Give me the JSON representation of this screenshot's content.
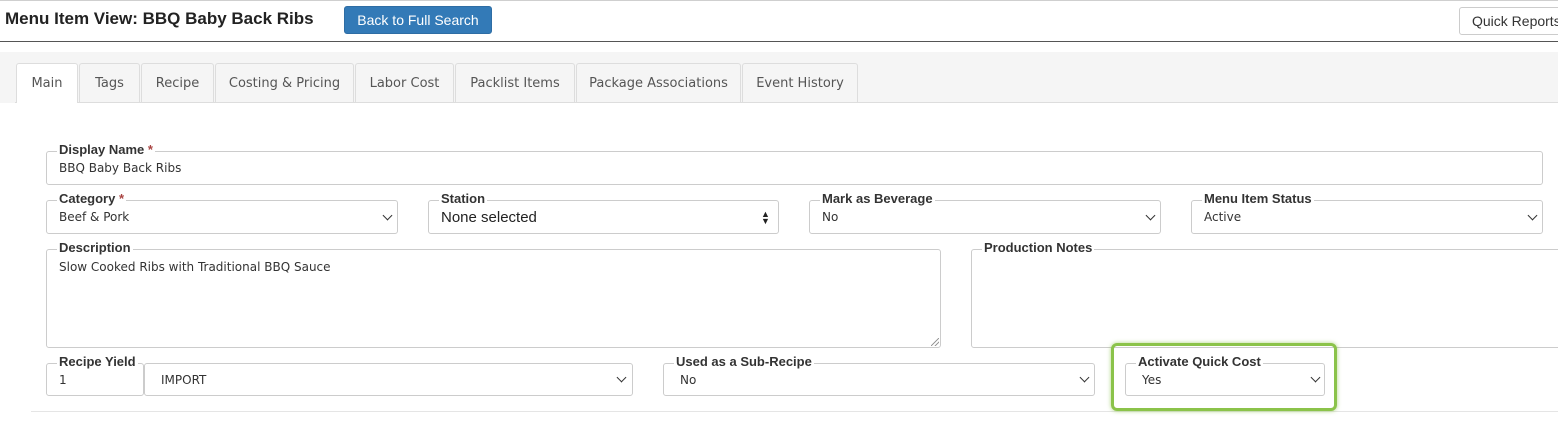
{
  "header": {
    "title": "Menu Item View: BBQ Baby Back Ribs",
    "back_button": "Back to Full Search",
    "quick_reports": "Quick Reports"
  },
  "tabs": [
    {
      "label": "Main",
      "active": true
    },
    {
      "label": "Tags"
    },
    {
      "label": "Recipe"
    },
    {
      "label": "Costing & Pricing"
    },
    {
      "label": "Labor Cost"
    },
    {
      "label": "Packlist Items"
    },
    {
      "label": "Package Associations"
    },
    {
      "label": "Event History"
    }
  ],
  "form": {
    "display_name": {
      "label": "Display Name",
      "required": "*",
      "value": "BBQ Baby Back Ribs"
    },
    "category": {
      "label": "Category",
      "required": "*",
      "value": "Beef & Pork"
    },
    "station": {
      "label": "Station",
      "value": "None selected"
    },
    "mark_as_beverage": {
      "label": "Mark as Beverage",
      "value": "No"
    },
    "menu_item_status": {
      "label": "Menu Item Status",
      "value": "Active"
    },
    "description": {
      "label": "Description",
      "value": "Slow Cooked Ribs with Traditional BBQ Sauce"
    },
    "production_notes": {
      "label": "Production Notes",
      "value": ""
    },
    "recipe_yield": {
      "label": "Recipe Yield",
      "value": "1",
      "unit": "IMPORT"
    },
    "used_as_sub_recipe": {
      "label": "Used as a Sub-Recipe",
      "value": "No"
    },
    "activate_quick_cost": {
      "label": "Activate Quick Cost",
      "value": "Yes"
    }
  },
  "colors": {
    "primary": "#337ab7",
    "highlight": "#8bc34a",
    "required": "#a94442"
  },
  "icons": [
    "chevron-down-icon",
    "sort-arrows-icon",
    "resize-handle-icon"
  ]
}
